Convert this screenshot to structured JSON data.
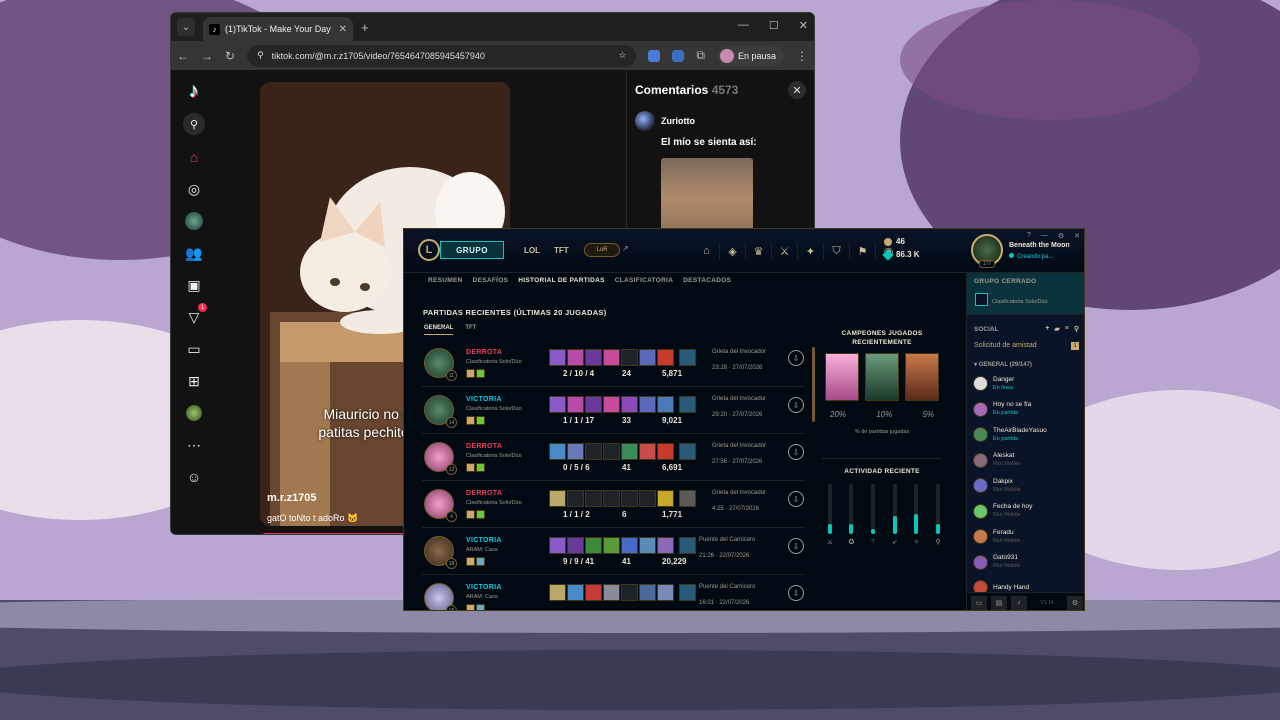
{
  "browser": {
    "tab_title": "(1)TikTok - Make Your Day",
    "url": "tiktok.com/@m.r.z1705/video/7654647085945457940",
    "profile_label": "En pausa"
  },
  "tiktok": {
    "notification_badge": "1",
    "video_caption": "Miauricio no sabe meter sus patitas pechito entonces esto:",
    "author": "m.r.z1705",
    "description": "gatO toNto t adoRo 🐱",
    "comments_title": "Comentarios",
    "comments_count": "4573",
    "comment_user": "Zuriotto",
    "comment_text": "El mío se sienta así:"
  },
  "lol": {
    "group_button": "GRUPO",
    "mode_lol": "LOL",
    "mode_tft": "TFT",
    "lor_label": "LoR",
    "blue_essence": "46",
    "riot_points": "86.3 K",
    "player_name": "Beneath the Moon",
    "player_status": "Creando pa...",
    "player_level": "177",
    "subnav": [
      "RESUMEN",
      "DESAFÍOS",
      "HISTORIAL DE PARTIDAS",
      "CLASIFICATORIA",
      "DESTACADOS"
    ],
    "section_title": "PARTIDAS RECIENTES (ÚLTIMAS 20 JUGADAS)",
    "queue_tabs": [
      "GENERAL",
      "TFT"
    ],
    "matches": [
      {
        "result": "DERROTA",
        "queue": "Clasificatoria Solo/Dúo",
        "kda": "2 / 10 / 4",
        "cs": "24",
        "gold": "5,871",
        "map": "Grieta del Invocador",
        "time": "23:28 · 27/07/2026",
        "level": "11"
      },
      {
        "result": "VICTORIA",
        "queue": "Clasificatoria Solo/Dúo",
        "kda": "1 / 1 / 17",
        "cs": "33",
        "gold": "9,021",
        "map": "Grieta del Invocador",
        "time": "29:20 · 27/07/2026",
        "level": "14"
      },
      {
        "result": "DERROTA",
        "queue": "Clasificatoria Solo/Dúo",
        "kda": "0 / 5 / 6",
        "cs": "41",
        "gold": "6,691",
        "map": "Grieta del Invocador",
        "time": "27:56 · 27/07/2026",
        "level": "12"
      },
      {
        "result": "DERROTA",
        "queue": "Clasificatoria Solo/Dúo",
        "kda": "1 / 1 / 2",
        "cs": "6",
        "gold": "1,771",
        "map": "Grieta del Invocador",
        "time": "4:25 · 27/07/2026",
        "level": "4"
      },
      {
        "result": "VICTORIA",
        "queue": "ARAM: Caos",
        "kda": "9 / 9 / 41",
        "cs": "41",
        "gold": "20,229",
        "map": "Puente del Carnicero",
        "time": "21:26 · 22/07/2026",
        "level": "18"
      },
      {
        "result": "VICTORIA",
        "queue": "ARAM: Caos",
        "kda": "",
        "cs": "",
        "gold": "",
        "map": "Puente del Carnicero",
        "time": "16:01 · 22/07/2026",
        "level": "15"
      }
    ],
    "champ_panel_title": "CAMPEONES JUGADOS RECIENTEMENTE",
    "champ_pcts": [
      "20%",
      "10%",
      "5%"
    ],
    "champ_sub": "% de partidas jugadas",
    "activity_title": "ACTIVIDAD RECIENTE",
    "activity_levels": [
      0.2,
      0.2,
      0.1,
      0.35,
      0.4,
      0.2
    ]
  },
  "social": {
    "closed_group_title": "GRUPO CERRADO",
    "closed_group_queue": "Clasificatoria Solo/Dúo",
    "header": "SOCIAL",
    "friend_request": "Solicitud de amistad",
    "friend_request_count": "1",
    "group_label": "GENERAL (29/147)",
    "friends": [
      {
        "name": "Danger",
        "status": "En línea",
        "mobile": false
      },
      {
        "name": "Hoy no se fía",
        "status": "En partida",
        "mobile": false
      },
      {
        "name": "TheAirBladeYasuo",
        "status": "En partida",
        "mobile": false
      },
      {
        "name": "Aleskat",
        "status": "Riot Mobile",
        "mobile": true
      },
      {
        "name": "Dakpix",
        "status": "Riot Mobile",
        "mobile": true
      },
      {
        "name": "Fecha de hoy",
        "status": "Riot Mobile",
        "mobile": true
      },
      {
        "name": "Feradu",
        "status": "Riot Mobile",
        "mobile": true
      },
      {
        "name": "Gato931",
        "status": "Riot Mobile",
        "mobile": true
      },
      {
        "name": "Handy Hand",
        "status": "",
        "mobile": true
      }
    ],
    "version": "V1.14"
  }
}
